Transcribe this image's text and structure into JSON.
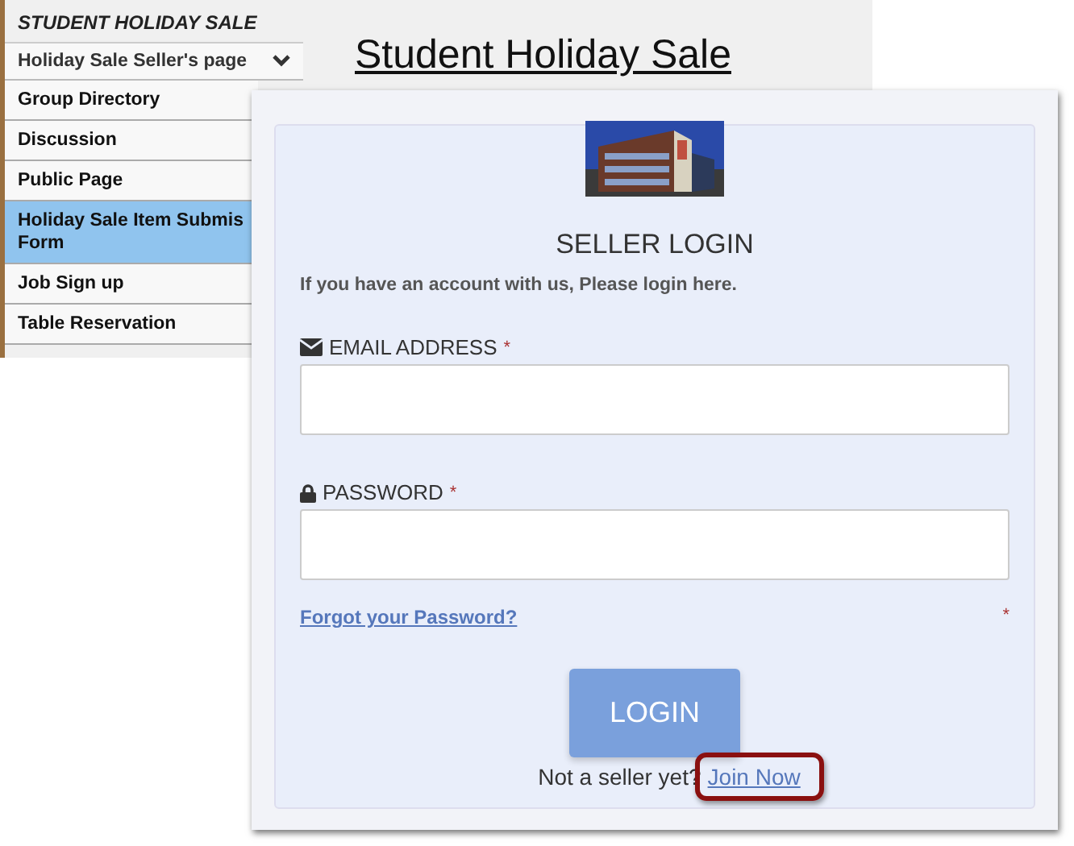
{
  "site": {
    "title": "STUDENT HOLIDAY SALE",
    "heading": "Student Holiday Sale",
    "dropdown": {
      "label": "Holiday Sale Seller's page"
    }
  },
  "sidebar": {
    "items": [
      {
        "label": "Group Directory",
        "selected": false
      },
      {
        "label": "Discussion",
        "selected": false
      },
      {
        "label": "Public Page",
        "selected": false
      },
      {
        "label": "Holiday Sale Item Submis\nForm",
        "selected": true
      },
      {
        "label": "Job Sign up",
        "selected": false
      },
      {
        "label": "Table Reservation",
        "selected": false
      }
    ]
  },
  "login": {
    "title": "SELLER LOGIN",
    "intro": "If you have an account with us, Please login here.",
    "fields": [
      {
        "kind": "email",
        "label": "EMAIL ADDRESS",
        "required_mark": "*"
      },
      {
        "kind": "password",
        "label": "PASSWORD",
        "required_mark": "*"
      }
    ],
    "forgot_link": "Forgot your Password?",
    "side_mark": "*",
    "button": "LOGIN",
    "signup_text": "Not a seller yet?",
    "signup_link": "Join Now",
    "signup_highlighted": true
  }
}
